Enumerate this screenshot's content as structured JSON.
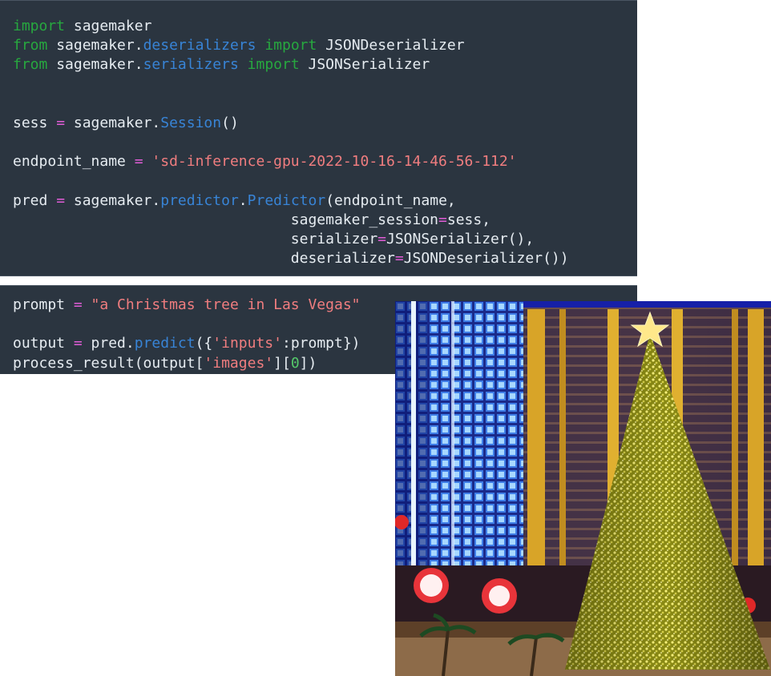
{
  "cells": [
    {
      "lines": [
        [
          {
            "t": "import",
            "c": "kw"
          },
          {
            "t": " sagemaker"
          }
        ],
        [
          {
            "t": "from",
            "c": "kw"
          },
          {
            "t": " sagemaker."
          },
          {
            "t": "deserializers",
            "c": "at"
          },
          {
            "t": " "
          },
          {
            "t": "import",
            "c": "kw"
          },
          {
            "t": " JSONDeserializer"
          }
        ],
        [
          {
            "t": "from",
            "c": "kw"
          },
          {
            "t": " sagemaker."
          },
          {
            "t": "serializers",
            "c": "at"
          },
          {
            "t": " "
          },
          {
            "t": "import",
            "c": "kw"
          },
          {
            "t": " JSONSerializer"
          }
        ],
        [],
        [],
        [
          {
            "t": "sess "
          },
          {
            "t": "=",
            "c": "op"
          },
          {
            "t": " sagemaker."
          },
          {
            "t": "Session",
            "c": "at"
          },
          {
            "t": "()"
          }
        ],
        [],
        [
          {
            "t": "endpoint_name "
          },
          {
            "t": "=",
            "c": "op"
          },
          {
            "t": " "
          },
          {
            "t": "'sd-inference-gpu-2022-10-16-14-46-56-112'",
            "c": "st"
          }
        ],
        [],
        [
          {
            "t": "pred "
          },
          {
            "t": "=",
            "c": "op"
          },
          {
            "t": " sagemaker."
          },
          {
            "t": "predictor",
            "c": "at"
          },
          {
            "t": "."
          },
          {
            "t": "Predictor",
            "c": "at"
          },
          {
            "t": "(endpoint_name,"
          }
        ],
        [
          {
            "t": "                                sagemaker_session"
          },
          {
            "t": "=",
            "c": "op"
          },
          {
            "t": "sess,"
          }
        ],
        [
          {
            "t": "                                serializer"
          },
          {
            "t": "=",
            "c": "op"
          },
          {
            "t": "JSONSerializer(),"
          }
        ],
        [
          {
            "t": "                                deserializer"
          },
          {
            "t": "=",
            "c": "op"
          },
          {
            "t": "JSONDeserializer())"
          }
        ]
      ]
    },
    {
      "lines": [
        [
          {
            "t": "prompt "
          },
          {
            "t": "=",
            "c": "op"
          },
          {
            "t": " "
          },
          {
            "t": "\"a Christmas tree in Las Vegas\"",
            "c": "st"
          }
        ],
        [],
        [
          {
            "t": "output "
          },
          {
            "t": "=",
            "c": "op"
          },
          {
            "t": " pred."
          },
          {
            "t": "predict",
            "c": "at"
          },
          {
            "t": "({"
          },
          {
            "t": "'inputs'",
            "c": "st"
          },
          {
            "t": ":prompt})"
          }
        ],
        [
          {
            "t": "process_result(output["
          },
          {
            "t": "'images'",
            "c": "st"
          },
          {
            "t": "]["
          },
          {
            "t": "0",
            "c": "nm"
          },
          {
            "t": "])"
          }
        ]
      ]
    }
  ],
  "colors": {
    "cell_bg": "#2b3540",
    "text": "#e6ecf1",
    "keyword": "#27a83f",
    "attribute": "#3884d6",
    "operator": "#e25dd8",
    "string": "#f07d7f",
    "number": "#55c86a"
  },
  "output_image": {
    "icon": "generated-image-christmas-tree"
  }
}
